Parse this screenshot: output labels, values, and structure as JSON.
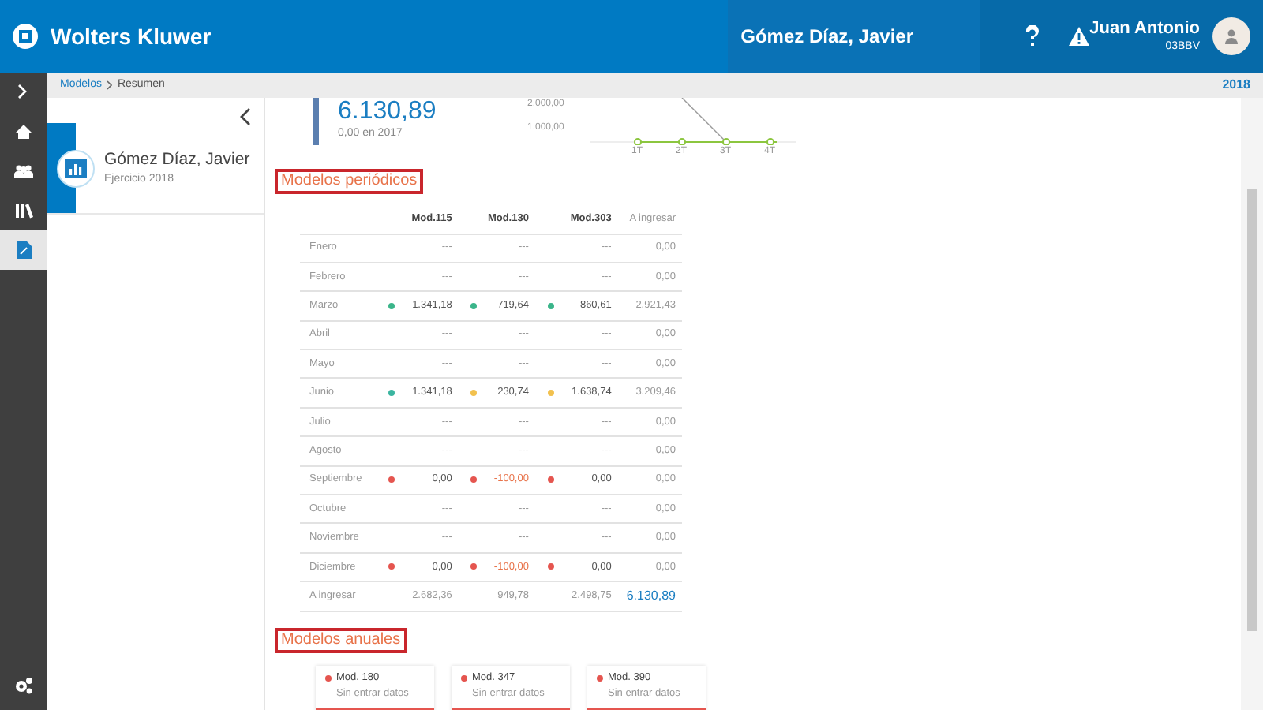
{
  "header": {
    "brand": "Wolters Kluwer",
    "client": "Gómez Díaz, Javier",
    "user_name": "Juan Antonio",
    "user_code": "03BBV"
  },
  "breadcrumb": {
    "items": [
      "Modelos",
      "Resumen"
    ],
    "year": "2018"
  },
  "nav": [
    {
      "selected": false
    },
    {
      "selected": false
    },
    {
      "selected": false
    },
    {
      "selected": false
    },
    {
      "selected": true
    }
  ],
  "client_card": {
    "name": "Gómez Díaz, Javier",
    "subtitle": "Ejercicio 2018"
  },
  "summary": {
    "total": "6.130,89",
    "previous": "0,00 en 2017",
    "y_labels": [
      "2.000,00",
      "1.000,00"
    ],
    "x_labels": [
      "1T",
      "2T",
      "3T",
      "4T"
    ]
  },
  "periodic": {
    "title": "Modelos periódicos",
    "columns": [
      "Mod.115",
      "Mod.130",
      "Mod.303",
      "A ingresar"
    ],
    "rows": [
      {
        "month": "Enero",
        "cells": [
          {
            "value": "---",
            "negative": false
          },
          {
            "value": "---",
            "negative": false
          },
          {
            "value": "---",
            "negative": false
          }
        ],
        "total": "0,00"
      },
      {
        "month": "Febrero",
        "cells": [
          {
            "value": "---",
            "negative": false
          },
          {
            "value": "---",
            "negative": false
          },
          {
            "value": "---",
            "negative": false
          }
        ],
        "total": "0,00"
      },
      {
        "month": "Marzo",
        "cells": [
          {
            "value": "1.341,18",
            "color": "#3bb58a",
            "negative": false
          },
          {
            "value": "719,64",
            "color": "#3bb58a",
            "negative": false
          },
          {
            "value": "860,61",
            "color": "#3bb58a",
            "negative": false
          }
        ],
        "total": "2.921,43"
      },
      {
        "month": "Abril",
        "cells": [
          {
            "value": "---",
            "negative": false
          },
          {
            "value": "---",
            "negative": false
          },
          {
            "value": "---",
            "negative": false
          }
        ],
        "total": "0,00"
      },
      {
        "month": "Mayo",
        "cells": [
          {
            "value": "---",
            "negative": false
          },
          {
            "value": "---",
            "negative": false
          },
          {
            "value": "---",
            "negative": false
          }
        ],
        "total": "0,00"
      },
      {
        "month": "Junio",
        "cells": [
          {
            "value": "1.341,18",
            "color": "#3bb5a0",
            "negative": false
          },
          {
            "value": "230,74",
            "color": "#f2c14e",
            "negative": false
          },
          {
            "value": "1.638,74",
            "color": "#f2c14e",
            "negative": false
          }
        ],
        "total": "3.209,46"
      },
      {
        "month": "Julio",
        "cells": [
          {
            "value": "---",
            "negative": false
          },
          {
            "value": "---",
            "negative": false
          },
          {
            "value": "---",
            "negative": false
          }
        ],
        "total": "0,00"
      },
      {
        "month": "Agosto",
        "cells": [
          {
            "value": "---",
            "negative": false
          },
          {
            "value": "---",
            "negative": false
          },
          {
            "value": "---",
            "negative": false
          }
        ],
        "total": "0,00"
      },
      {
        "month": "Septiembre",
        "cells": [
          {
            "value": "0,00",
            "color": "#e5554f",
            "negative": false
          },
          {
            "value": "-100,00",
            "color": "#e5554f",
            "negative": true
          },
          {
            "value": "0,00",
            "color": "#e5554f",
            "negative": false
          }
        ],
        "total": "0,00"
      },
      {
        "month": "Octubre",
        "cells": [
          {
            "value": "---",
            "negative": false
          },
          {
            "value": "---",
            "negative": false
          },
          {
            "value": "---",
            "negative": false
          }
        ],
        "total": "0,00"
      },
      {
        "month": "Noviembre",
        "cells": [
          {
            "value": "---",
            "negative": false
          },
          {
            "value": "---",
            "negative": false
          },
          {
            "value": "---",
            "negative": false
          }
        ],
        "total": "0,00"
      },
      {
        "month": "Diciembre",
        "cells": [
          {
            "value": "0,00",
            "color": "#e5554f",
            "negative": false
          },
          {
            "value": "-100,00",
            "color": "#e5554f",
            "negative": true
          },
          {
            "value": "0,00",
            "color": "#e5554f",
            "negative": false
          }
        ],
        "total": "0,00"
      }
    ],
    "footer": {
      "label": "A ingresar",
      "values": [
        "2.682,36",
        "949,78",
        "2.498,75"
      ],
      "total": "6.130,89"
    }
  },
  "annual": {
    "title": "Modelos anuales",
    "cards": [
      {
        "name": "Mod. 180",
        "status": "Sin entrar datos",
        "color": "#e5554f"
      },
      {
        "name": "Mod. 347",
        "status": "Sin entrar datos",
        "color": "#e5554f"
      },
      {
        "name": "Mod. 390",
        "status": "Sin entrar datos",
        "color": "#e5554f"
      }
    ]
  }
}
